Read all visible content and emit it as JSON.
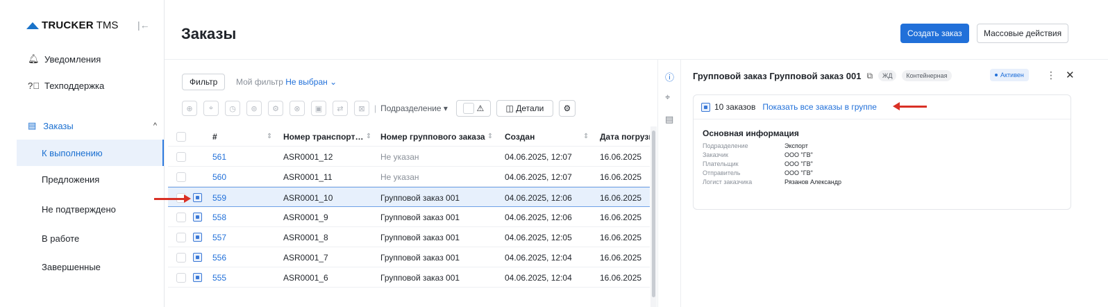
{
  "app": {
    "logo_bold": "TRUCKER",
    "logo_light": "TMS",
    "accent": "#2170d9"
  },
  "sidebar": {
    "notifications": "Уведомления",
    "support": "Техподдержка",
    "orders_group": "Заказы",
    "items": [
      {
        "label": "К выполнению",
        "active": true
      },
      {
        "label": "Предложения"
      },
      {
        "label": "Не подтверждено"
      },
      {
        "label": "В работе"
      },
      {
        "label": "Завершенные"
      }
    ]
  },
  "header": {
    "title": "Заказы",
    "create_label": "Создать заказ",
    "bulk_label": "Массовые действия"
  },
  "filters": {
    "filter_label": "Фильтр",
    "my_filter_label": "Мой фильтр",
    "my_filter_value": "Не выбран",
    "division_label": "Подразделение",
    "details_label": "Детали"
  },
  "table": {
    "columns": [
      "#",
      "Номер транспорт…",
      "Номер группового заказа",
      "Создан",
      "Дата погрузк"
    ],
    "rows": [
      {
        "id": "561",
        "transport": "ASR0001_12",
        "group": "Не указан",
        "created": "04.06.2025, 12:07",
        "load": "16.06.2025",
        "grouped": false,
        "selected": false
      },
      {
        "id": "560",
        "transport": "ASR0001_11",
        "group": "Не указан",
        "created": "04.06.2025, 12:07",
        "load": "16.06.2025",
        "grouped": false,
        "selected": false
      },
      {
        "id": "559",
        "transport": "ASR0001_10",
        "group": "Групповой заказ 001",
        "created": "04.06.2025, 12:06",
        "load": "16.06.2025",
        "grouped": true,
        "selected": true
      },
      {
        "id": "558",
        "transport": "ASR0001_9",
        "group": "Групповой заказ 001",
        "created": "04.06.2025, 12:06",
        "load": "16.06.2025",
        "grouped": true,
        "selected": false
      },
      {
        "id": "557",
        "transport": "ASR0001_8",
        "group": "Групповой заказ 001",
        "created": "04.06.2025, 12:05",
        "load": "16.06.2025",
        "grouped": true,
        "selected": false
      },
      {
        "id": "556",
        "transport": "ASR0001_7",
        "group": "Групповой заказ 001",
        "created": "04.06.2025, 12:04",
        "load": "16.06.2025",
        "grouped": true,
        "selected": false
      },
      {
        "id": "555",
        "transport": "ASR0001_6",
        "group": "Групповой заказ 001",
        "created": "04.06.2025, 12:04",
        "load": "16.06.2025",
        "grouped": true,
        "selected": false
      }
    ]
  },
  "panel": {
    "title": "Групповой заказ Групповой заказ 001",
    "tag_rail": "ЖД",
    "tag_container": "Контейнерная",
    "status": "Активен",
    "orders_count": "10 заказов",
    "show_all_link": "Показать все заказы в группе",
    "info_title": "Основная информация",
    "info": [
      {
        "key": "Подразделение",
        "value": "Экспорт"
      },
      {
        "key": "Заказчик",
        "value": "ООО \"ГВ\""
      },
      {
        "key": "Плательщик",
        "value": "ООО \"ГВ\""
      },
      {
        "key": "Отправитель",
        "value": "ООО \"ГВ\""
      },
      {
        "key": "Логист заказчика",
        "value": "Рязанов Александр"
      }
    ]
  },
  "icons": [
    "bell-icon",
    "help-icon",
    "calendar-icon",
    "chevron-up-icon",
    "collapse-sidebar-icon",
    "info-icon",
    "copy-icon",
    "more-icon",
    "close-icon",
    "group-order-icon"
  ]
}
